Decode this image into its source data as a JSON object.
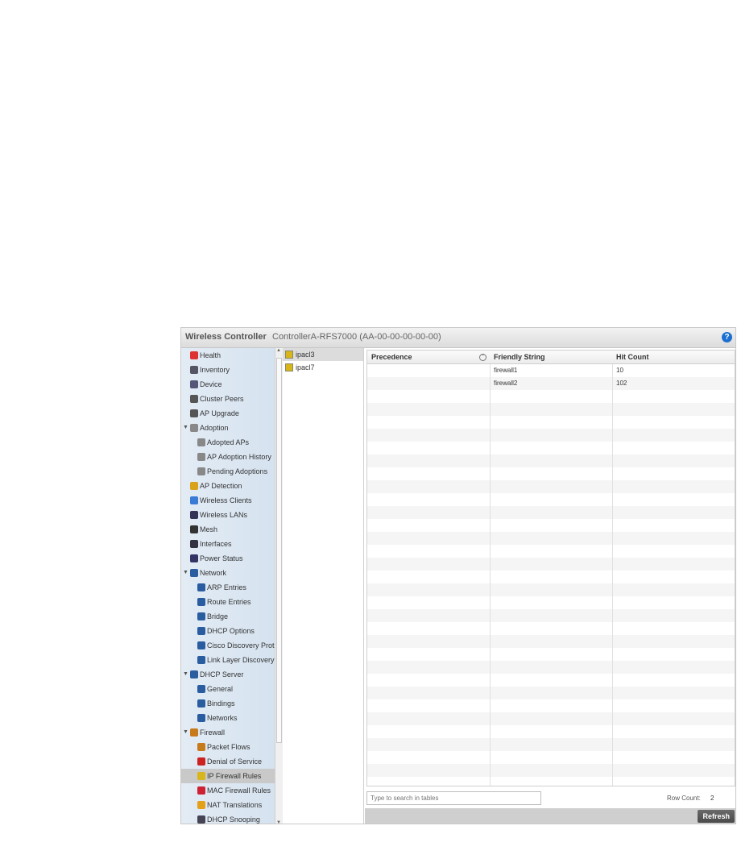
{
  "header": {
    "title": "Wireless Controller",
    "device": "ControllerA-RFS7000 (AA-00-00-00-00-00)",
    "help_icon": "?"
  },
  "tree": {
    "items": [
      {
        "label": "Health",
        "icon": "health-icon",
        "indent": 0
      },
      {
        "label": "Inventory",
        "icon": "inventory-icon",
        "indent": 0
      },
      {
        "label": "Device",
        "icon": "device-icon",
        "indent": 0
      },
      {
        "label": "Cluster Peers",
        "icon": "cluster-icon",
        "indent": 0
      },
      {
        "label": "AP Upgrade",
        "icon": "upgrade-icon",
        "indent": 0
      },
      {
        "label": "Adoption",
        "icon": "adoption-icon",
        "indent": 0,
        "expanded": true
      },
      {
        "label": "Adopted APs",
        "icon": "adoption-icon",
        "indent": 1
      },
      {
        "label": "AP Adoption History",
        "icon": "adoption-icon",
        "indent": 1
      },
      {
        "label": "Pending Adoptions",
        "icon": "adoption-icon",
        "indent": 1
      },
      {
        "label": "AP Detection",
        "icon": "detection-icon",
        "indent": 0
      },
      {
        "label": "Wireless Clients",
        "icon": "clients-icon",
        "indent": 0
      },
      {
        "label": "Wireless LANs",
        "icon": "wlan-icon",
        "indent": 0
      },
      {
        "label": "Mesh",
        "icon": "mesh-icon",
        "indent": 0
      },
      {
        "label": "Interfaces",
        "icon": "interfaces-icon",
        "indent": 0
      },
      {
        "label": "Power Status",
        "icon": "power-icon",
        "indent": 0
      },
      {
        "label": "Network",
        "icon": "network-icon",
        "indent": 0,
        "expanded": true
      },
      {
        "label": "ARP Entries",
        "icon": "arp-icon",
        "indent": 1
      },
      {
        "label": "Route Entries",
        "icon": "route-icon",
        "indent": 1
      },
      {
        "label": "Bridge",
        "icon": "bridge-icon",
        "indent": 1
      },
      {
        "label": "DHCP Options",
        "icon": "dhcp-icon",
        "indent": 1
      },
      {
        "label": "Cisco Discovery Prot",
        "icon": "dhcp-icon",
        "indent": 1
      },
      {
        "label": "Link Layer Discovery",
        "icon": "dhcp-icon",
        "indent": 1
      },
      {
        "label": "DHCP Server",
        "icon": "dhcp-icon",
        "indent": 0,
        "expanded": true
      },
      {
        "label": "General",
        "icon": "dhcp-icon",
        "indent": 1
      },
      {
        "label": "Bindings",
        "icon": "dhcp-icon",
        "indent": 1
      },
      {
        "label": "Networks",
        "icon": "dhcp-icon",
        "indent": 1
      },
      {
        "label": "Firewall",
        "icon": "firewall-icon",
        "indent": 0,
        "expanded": true
      },
      {
        "label": "Packet Flows",
        "icon": "firewall-icon",
        "indent": 1
      },
      {
        "label": "Denial of Service",
        "icon": "dos-icon",
        "indent": 1
      },
      {
        "label": "IP Firewall Rules",
        "icon": "acl-icon",
        "indent": 1,
        "selected": true
      },
      {
        "label": "MAC Firewall Rules",
        "icon": "mac-icon",
        "indent": 1
      },
      {
        "label": "NAT Translations",
        "icon": "nat-icon",
        "indent": 1
      },
      {
        "label": "DHCP Snooping",
        "icon": "snoop-icon",
        "indent": 1
      }
    ]
  },
  "acl_list": {
    "items": [
      {
        "label": "ipacl3",
        "selected": true
      },
      {
        "label": "ipacl7",
        "selected": false
      }
    ]
  },
  "table": {
    "columns": [
      "Precedence",
      "Friendly String",
      "Hit Count"
    ],
    "rows": [
      [
        "",
        "firewall1",
        "10"
      ],
      [
        "",
        "firewall2",
        "102"
      ]
    ]
  },
  "footer": {
    "search_placeholder": "Type to search in tables",
    "row_count_label": "Row Count:",
    "row_count_value": "2",
    "refresh_label": "Refresh"
  },
  "colors": {
    "help": "#1b6fd0",
    "tree_bg": "#dbe6f1",
    "refresh_bg": "#555555"
  }
}
